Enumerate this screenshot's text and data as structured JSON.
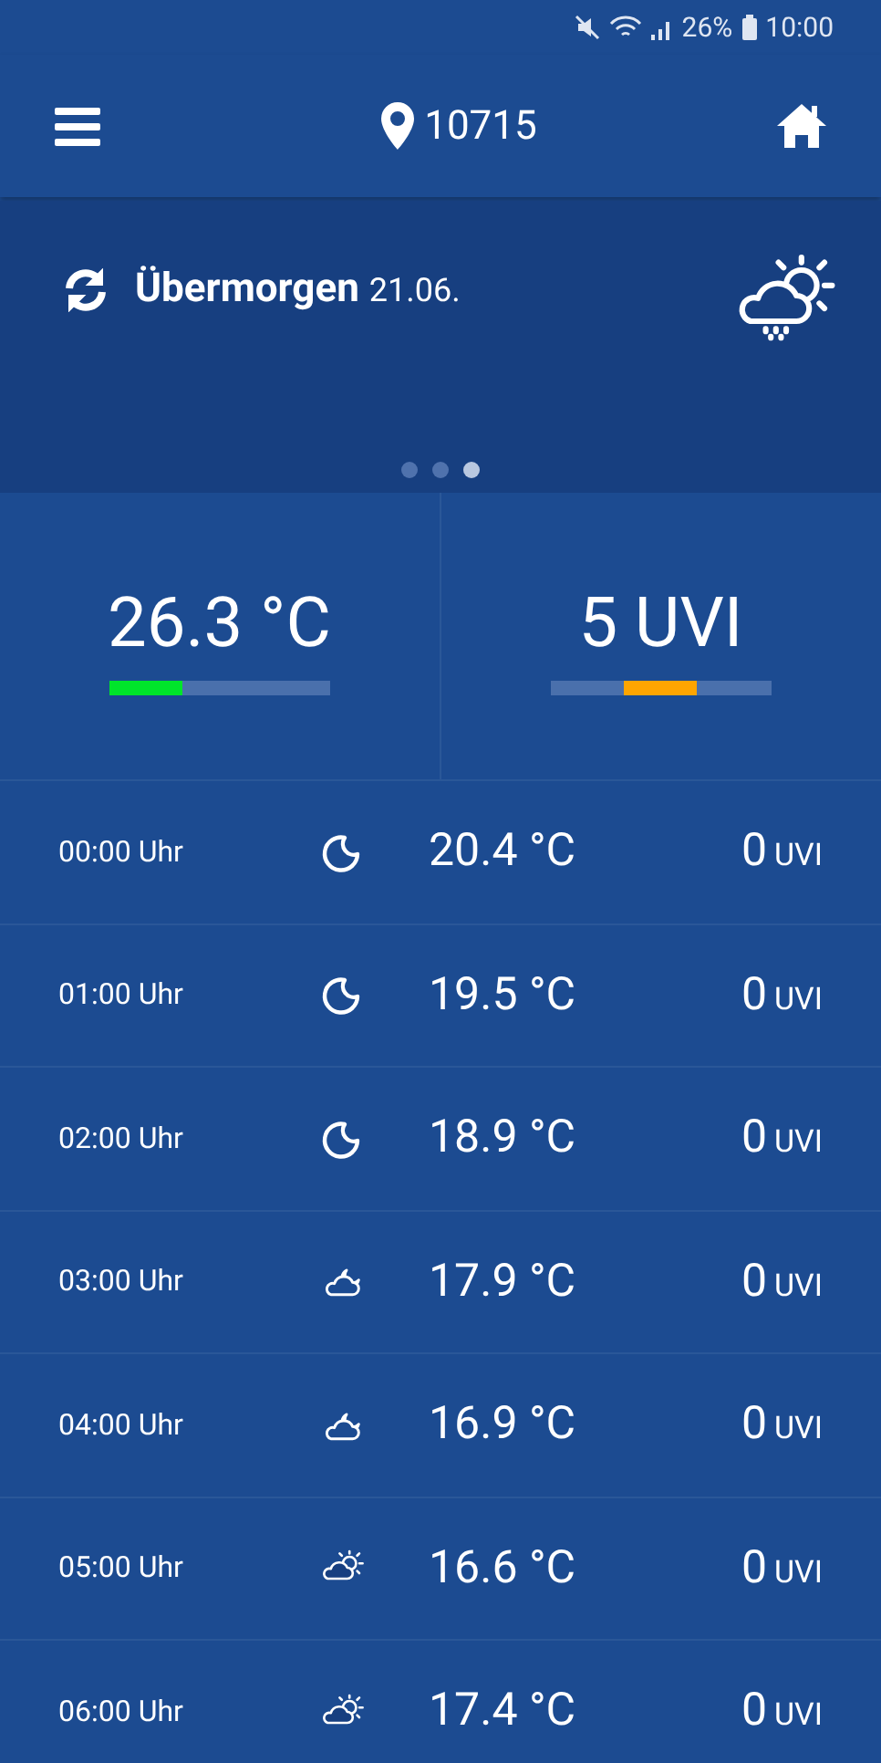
{
  "status_bar": {
    "battery": "26%",
    "time": "10:00"
  },
  "header": {
    "location": "10715"
  },
  "forecast_card": {
    "title": "Übermorgen",
    "date": "21.06.",
    "kind": "rain-sun",
    "pages": [
      {
        "selected": false
      },
      {
        "selected": false
      },
      {
        "selected": true
      }
    ]
  },
  "summary": [
    {
      "kind": "fill",
      "value": "26.3 °C",
      "level": 0.33,
      "color": "#00e52a"
    },
    {
      "kind": "marker",
      "value": "5 UVI",
      "level": 0.5,
      "color": "#ffa500"
    }
  ],
  "hours": [
    {
      "time": "00:00 Uhr",
      "kind": "moon",
      "temperature": "20.4 °C",
      "uv": "0",
      "uv_unit": "UVI"
    },
    {
      "time": "01:00 Uhr",
      "kind": "moon",
      "temperature": "19.5 °C",
      "uv": "0",
      "uv_unit": "UVI"
    },
    {
      "time": "02:00 Uhr",
      "kind": "moon",
      "temperature": "18.9 °C",
      "uv": "0",
      "uv_unit": "UVI"
    },
    {
      "time": "03:00 Uhr",
      "kind": "cloud-moon",
      "temperature": "17.9 °C",
      "uv": "0",
      "uv_unit": "UVI"
    },
    {
      "time": "04:00 Uhr",
      "kind": "cloud-moon",
      "temperature": "16.9 °C",
      "uv": "0",
      "uv_unit": "UVI"
    },
    {
      "time": "05:00 Uhr",
      "kind": "cloud-sun",
      "temperature": "16.6 °C",
      "uv": "0",
      "uv_unit": "UVI"
    },
    {
      "time": "06:00 Uhr",
      "kind": "cloud-sun",
      "temperature": "17.4 °C",
      "uv": "0",
      "uv_unit": "UVI"
    }
  ]
}
